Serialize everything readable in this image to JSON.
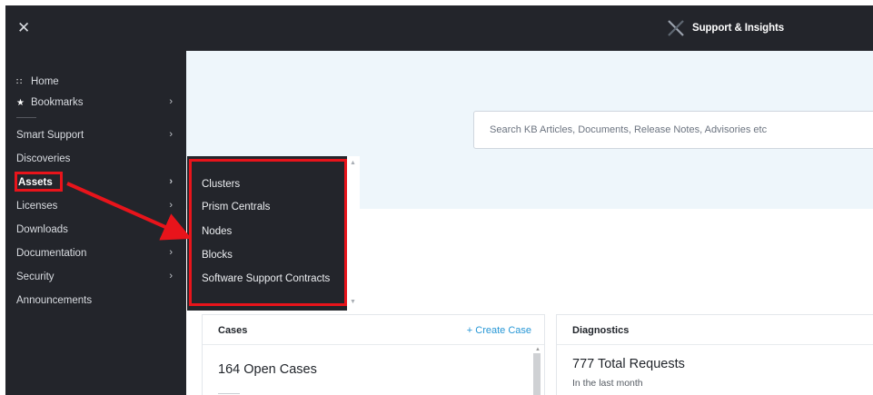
{
  "header": {
    "close_icon": "✕",
    "brand_title": "Support & Insights"
  },
  "sidebar": {
    "home": "Home",
    "bookmarks": "Bookmarks",
    "smart_support": "Smart Support",
    "discoveries": "Discoveries",
    "assets": "Assets",
    "licenses": "Licenses",
    "downloads": "Downloads",
    "documentation": "Documentation",
    "security": "Security",
    "announcements": "Announcements",
    "chevron": "›",
    "home_icon": "∷",
    "bookmark_icon": "★"
  },
  "search": {
    "placeholder": "Search KB Articles, Documents, Release Notes, Advisories etc"
  },
  "flyout": {
    "items": [
      "Clusters",
      "Prism Centrals",
      "Nodes",
      "Blocks",
      "Software Support Contracts"
    ]
  },
  "cases": {
    "title": "Cases",
    "create_link": "+ Create Case",
    "count_text": "164 Open Cases"
  },
  "diagnostics": {
    "title": "Diagnostics",
    "requests_text": "777 Total Requests",
    "period_text": "In the last month"
  },
  "colors": {
    "sidebar_bg": "#23252b",
    "hero_bg": "#eef6fb",
    "highlight": "#e8141b",
    "link": "#2797d6"
  }
}
